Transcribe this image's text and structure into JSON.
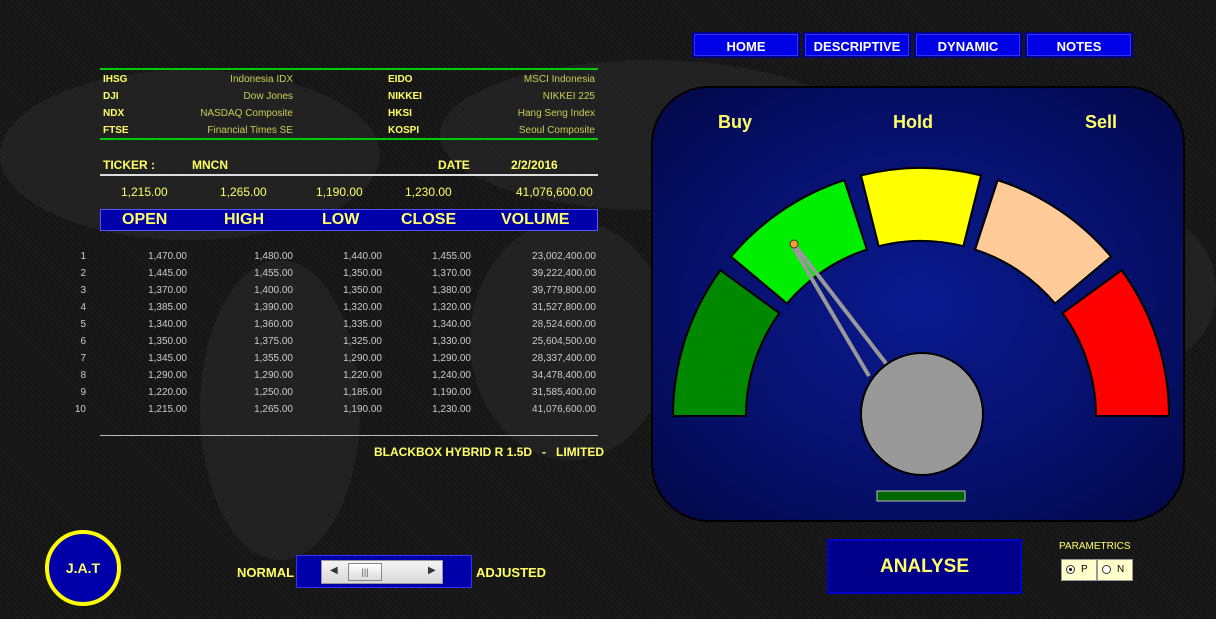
{
  "nav": [
    {
      "label": "HOME"
    },
    {
      "label": "DESCRIPTIVE"
    },
    {
      "label": "DYNAMIC"
    },
    {
      "label": "NOTES"
    }
  ],
  "indices_left": [
    {
      "code": "IHSG",
      "name": "Indonesia IDX"
    },
    {
      "code": "DJI",
      "name": "Dow Jones"
    },
    {
      "code": "NDX",
      "name": "NASDAQ Composite"
    },
    {
      "code": "FTSE",
      "name": "Financial Times SE"
    }
  ],
  "indices_right": [
    {
      "code": "EIDO",
      "name": "MSCI Indonesia"
    },
    {
      "code": "NIKKEI",
      "name": "NIKKEI 225"
    },
    {
      "code": "HKSI",
      "name": "Hang Seng Index"
    },
    {
      "code": "KOSPI",
      "name": "Seoul Composite"
    }
  ],
  "ticker": {
    "label": "TICKER :",
    "value": "MNCN"
  },
  "date": {
    "label": "DATE",
    "value": "2/2/2016"
  },
  "current": {
    "open": "1,215.00",
    "high": "1,265.00",
    "low": "1,190.00",
    "close": "1,230.00",
    "volume": "41,076,600.00"
  },
  "columns": {
    "open": "OPEN",
    "high": "HIGH",
    "low": "LOW",
    "close": "CLOSE",
    "volume": "VOLUME"
  },
  "rows": [
    {
      "n": "1",
      "open": "1,470.00",
      "high": "1,480.00",
      "low": "1,440.00",
      "close": "1,455.00",
      "volume": "23,002,400.00"
    },
    {
      "n": "2",
      "open": "1,445.00",
      "high": "1,455.00",
      "low": "1,350.00",
      "close": "1,370.00",
      "volume": "39,222,400.00"
    },
    {
      "n": "3",
      "open": "1,370.00",
      "high": "1,400.00",
      "low": "1,350.00",
      "close": "1,380.00",
      "volume": "39,779,800.00"
    },
    {
      "n": "4",
      "open": "1,385.00",
      "high": "1,390.00",
      "low": "1,320.00",
      "close": "1,320.00",
      "volume": "31,527,800.00"
    },
    {
      "n": "5",
      "open": "1,340.00",
      "high": "1,360.00",
      "low": "1,335.00",
      "close": "1,340.00",
      "volume": "28,524,600.00"
    },
    {
      "n": "6",
      "open": "1,350.00",
      "high": "1,375.00",
      "low": "1,325.00",
      "close": "1,330.00",
      "volume": "25,604,500.00"
    },
    {
      "n": "7",
      "open": "1,345.00",
      "high": "1,355.00",
      "low": "1,290.00",
      "close": "1,290.00",
      "volume": "28,337,400.00"
    },
    {
      "n": "8",
      "open": "1,290.00",
      "high": "1,290.00",
      "low": "1,220.00",
      "close": "1,240.00",
      "volume": "34,478,400.00"
    },
    {
      "n": "9",
      "open": "1,220.00",
      "high": "1,250.00",
      "low": "1,185.00",
      "close": "1,190.00",
      "volume": "31,585,400.00"
    },
    {
      "n": "10",
      "open": "1,215.00",
      "high": "1,265.00",
      "low": "1,190.00",
      "close": "1,230.00",
      "volume": "41,076,600.00"
    }
  ],
  "footer_model": "BLACKBOX HYBRID R 1.5D   -   LIMITED",
  "gauge": {
    "labels": {
      "buy": "Buy",
      "hold": "Hold",
      "sell": "Sell"
    },
    "segment_colors": [
      "#008800",
      "#00ee00",
      "#ffff00",
      "#ffcc99",
      "#ff0000"
    ],
    "indicator_color": "#006600",
    "needle_color": "#999999"
  },
  "logo_text": "J.A.T",
  "mode": {
    "normal": "NORMAL",
    "adjusted": "ADJUSTED",
    "thumb_icon": "grip-icon"
  },
  "analyse_label": "ANALYSE",
  "parametrics": {
    "label": "PARAMETRICS",
    "p": "P",
    "n": "N"
  }
}
